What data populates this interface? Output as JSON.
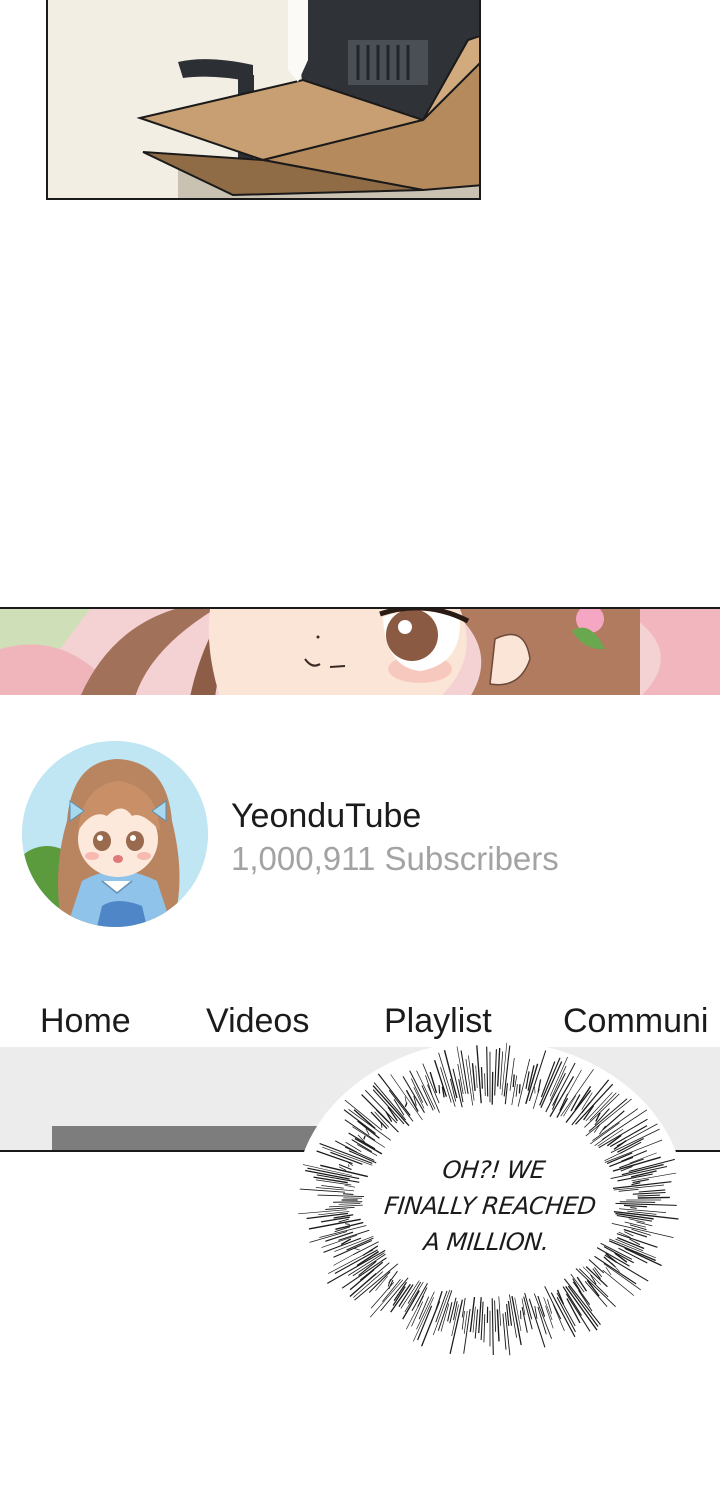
{
  "channel": {
    "name": "YeonduTube",
    "subscriber_count": "1,000,911",
    "subscriber_label": "Subscribers"
  },
  "tabs": [
    {
      "label": "Home"
    },
    {
      "label": "Videos"
    },
    {
      "label": "Playlist"
    },
    {
      "label": "Communi"
    }
  ],
  "speech_bubble": {
    "lines": [
      "OH?! WE",
      "FINALLY REACHED",
      "A MILLION."
    ]
  },
  "colors": {
    "subscriber_text": "#a3a3a3",
    "tab_bar_background": "#ececec",
    "progress_fill": "#7d7d7d",
    "avatar_background": "#bfe6f2"
  }
}
